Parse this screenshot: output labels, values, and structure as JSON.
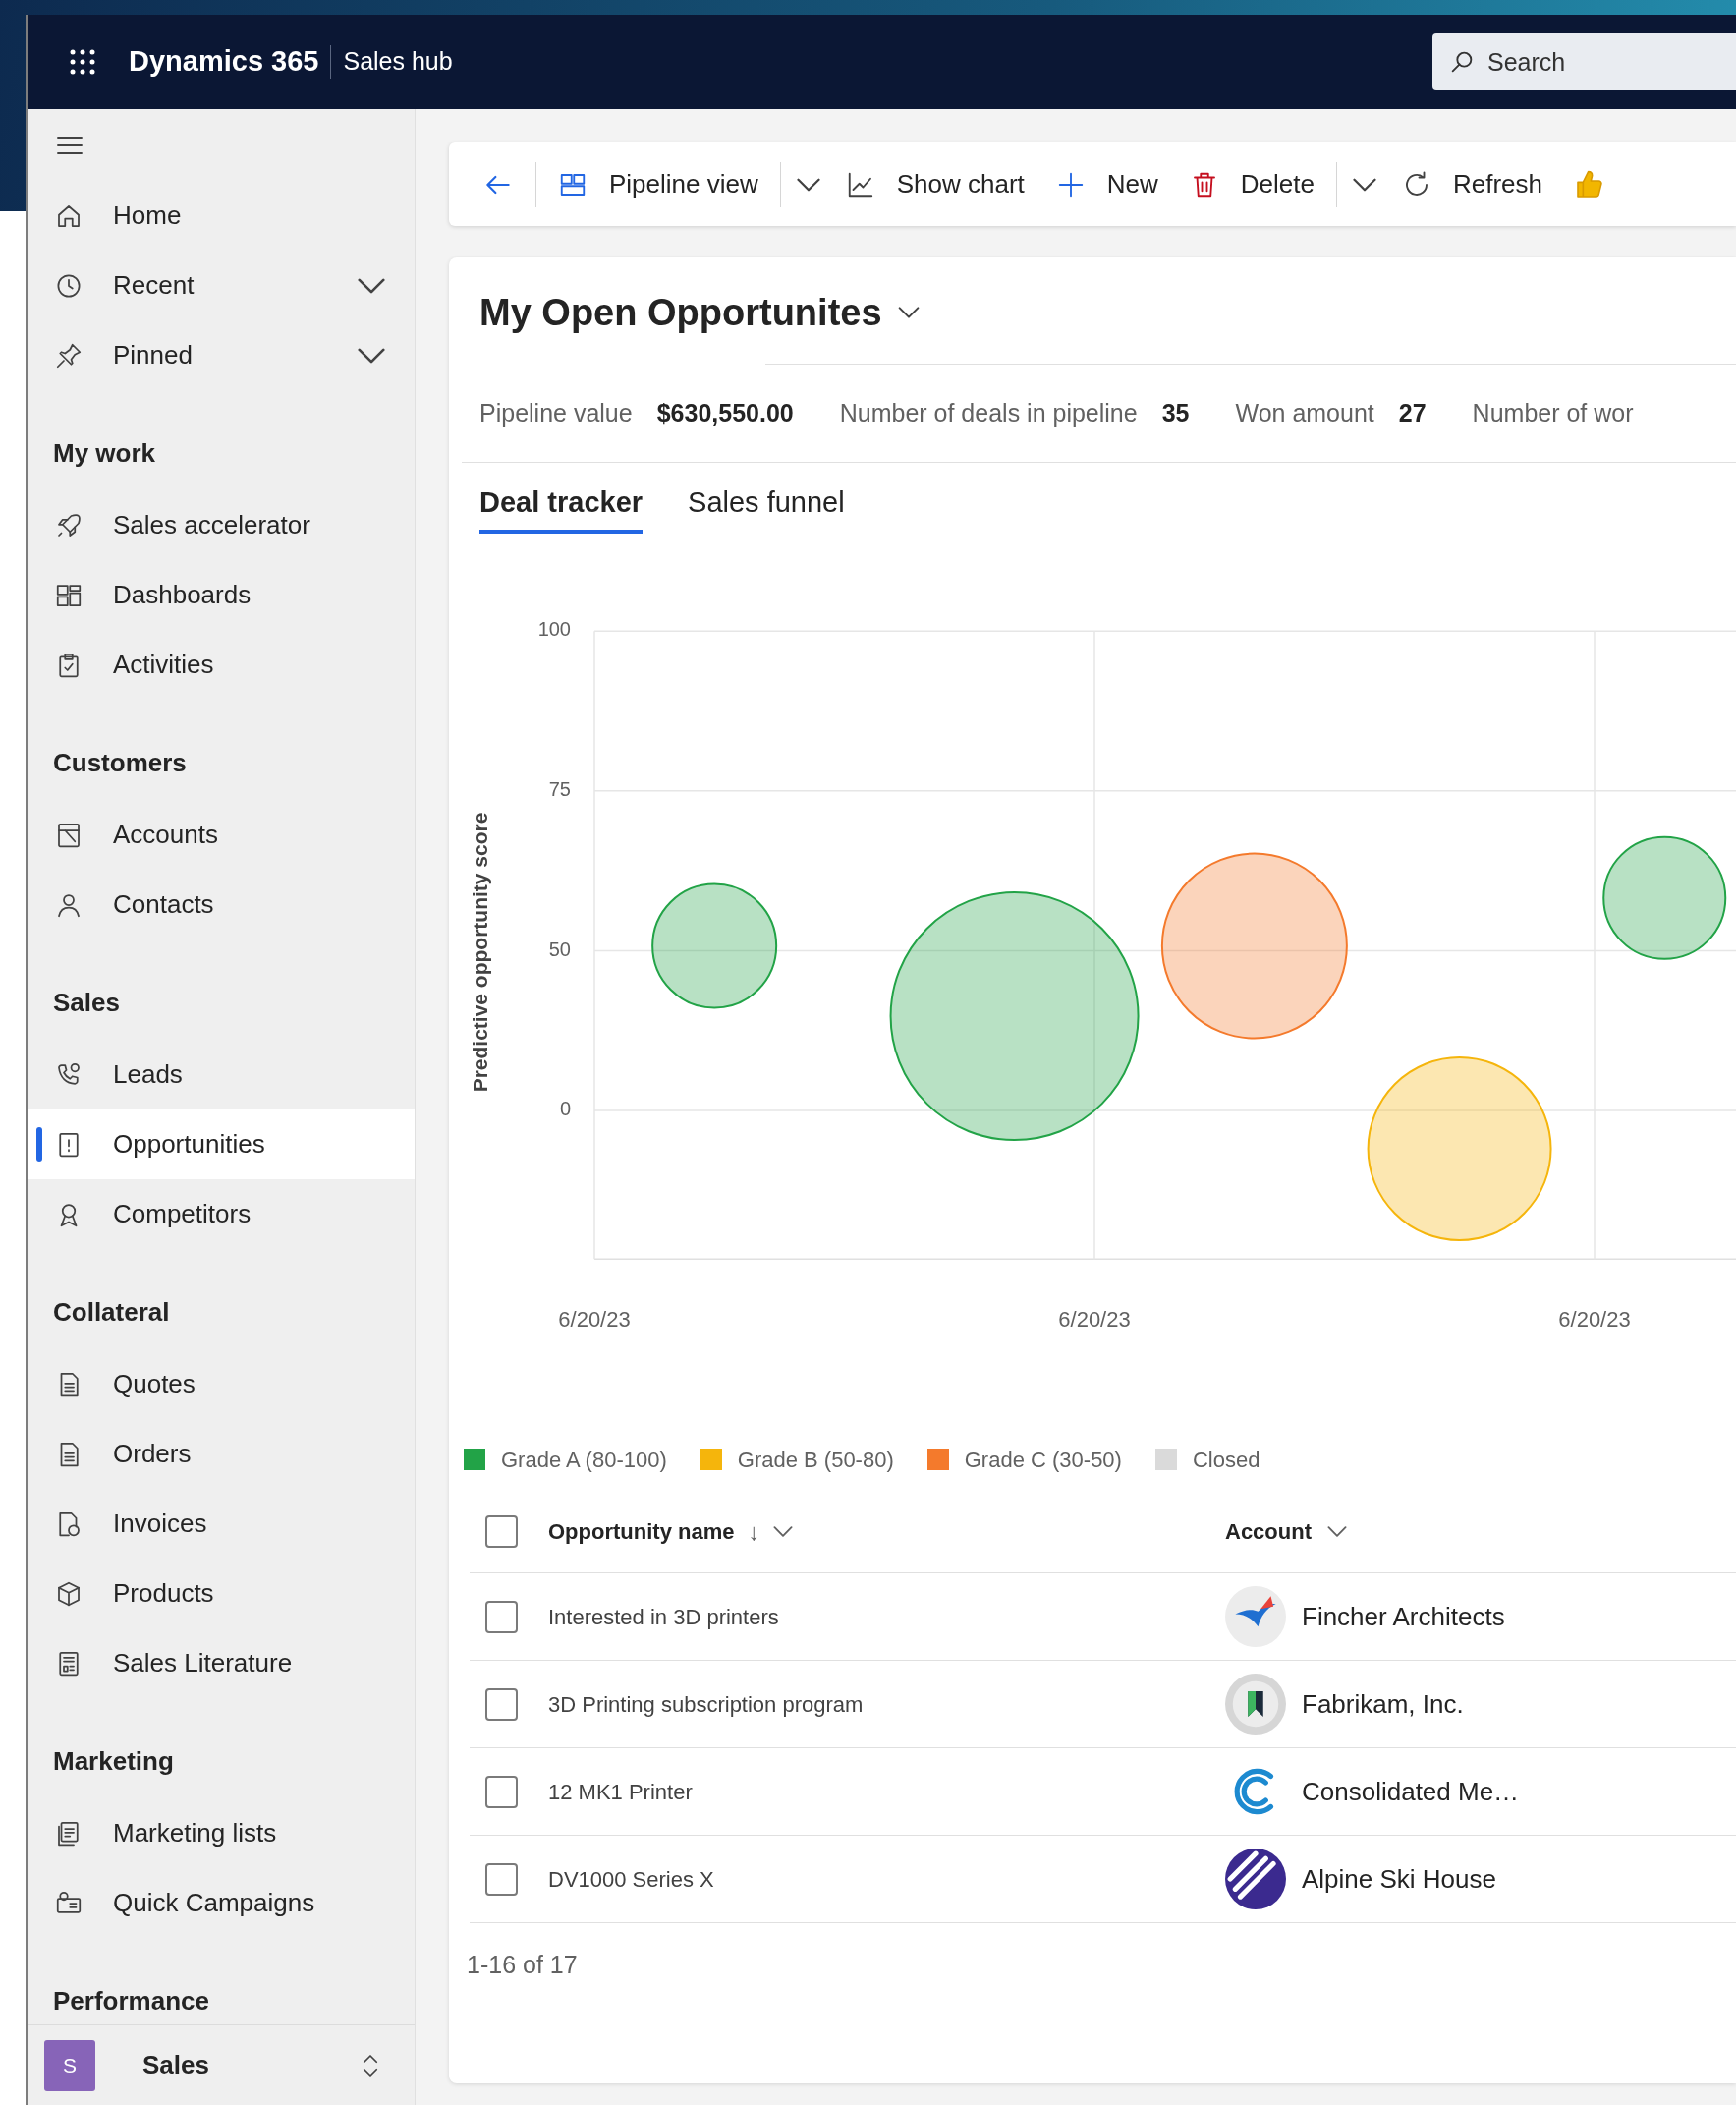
{
  "top_bar": {
    "app_name": "Dynamics 365",
    "area": "Sales hub",
    "search": {
      "placeholder": "Search"
    }
  },
  "sidebar": {
    "groups": [
      {
        "items": [
          {
            "label": "Home",
            "kind": "link",
            "selected": false
          },
          {
            "label": "Recent",
            "kind": "expandable",
            "selected": false
          },
          {
            "label": "Pinned",
            "kind": "expandable",
            "selected": false
          }
        ]
      },
      {
        "header": "My work",
        "items": [
          {
            "label": "Sales accelerator",
            "kind": "link",
            "selected": false
          },
          {
            "label": "Dashboards",
            "kind": "link",
            "selected": false
          },
          {
            "label": "Activities",
            "kind": "link",
            "selected": false
          }
        ]
      },
      {
        "header": "Customers",
        "items": [
          {
            "label": "Accounts",
            "kind": "link",
            "selected": false
          },
          {
            "label": "Contacts",
            "kind": "link",
            "selected": false
          }
        ]
      },
      {
        "header": "Sales",
        "items": [
          {
            "label": "Leads",
            "kind": "link",
            "selected": false
          },
          {
            "label": "Opportunities",
            "kind": "link",
            "selected": true
          },
          {
            "label": "Competitors",
            "kind": "link",
            "selected": false
          }
        ]
      },
      {
        "header": "Collateral",
        "items": [
          {
            "label": "Quotes",
            "kind": "link",
            "selected": false
          },
          {
            "label": "Orders",
            "kind": "link",
            "selected": false
          },
          {
            "label": "Invoices",
            "kind": "link",
            "selected": false
          },
          {
            "label": "Products",
            "kind": "link",
            "selected": false
          },
          {
            "label": "Sales Literature",
            "kind": "link",
            "selected": false
          }
        ]
      },
      {
        "header": "Marketing",
        "items": [
          {
            "label": "Marketing lists",
            "kind": "link",
            "selected": false
          },
          {
            "label": "Quick Campaigns",
            "kind": "link",
            "selected": false
          }
        ]
      },
      {
        "header": "Performance"
      }
    ],
    "area_switcher": {
      "initial": "S",
      "label": "Sales"
    }
  },
  "toolbar": [
    {
      "kind": "back"
    },
    {
      "kind": "button",
      "label": "Pipeline view"
    },
    {
      "kind": "dropdown"
    },
    {
      "kind": "button",
      "label": "Show chart"
    },
    {
      "kind": "button",
      "label": "New"
    },
    {
      "kind": "button",
      "label": "Delete"
    },
    {
      "kind": "dropdown"
    },
    {
      "kind": "button",
      "label": "Refresh"
    },
    {
      "kind": "overflow"
    }
  ],
  "view": {
    "title": "My Open Opportunites",
    "kpis": [
      {
        "label": "Pipeline value",
        "value": "$630,550.00"
      },
      {
        "label": "Number of deals in pipeline",
        "value": "35"
      },
      {
        "label": "Won amount",
        "value": "27"
      },
      {
        "label": "Number of wor"
      }
    ],
    "tabs": [
      {
        "label": "Deal tracker",
        "selected": true
      },
      {
        "label": "Sales funnel",
        "selected": false
      }
    ],
    "chart": {
      "ylabel": "Predictive opportunity score",
      "yticks": [
        "100",
        "75",
        "50",
        "0"
      ],
      "xticks": [
        "6/20/23",
        "6/20/23",
        "6/20/23"
      ],
      "legend": [
        {
          "label": "Grade A (80-100)",
          "color": "#22a347"
        },
        {
          "label": "Grade B (50-80)",
          "color": "#f5b50c"
        },
        {
          "label": "Grade C (30-50)",
          "color": "#f47a2c"
        },
        {
          "label": "Closed",
          "color": "#dadada"
        }
      ]
    },
    "table": {
      "columns": [
        {
          "label": "Opportunity name",
          "sort_mark": "↓"
        },
        {
          "label": "Account"
        }
      ],
      "select_all_checked": false,
      "rows": [
        {
          "checked": false,
          "name": "Interested in 3D printers",
          "account": "Fincher Architects"
        },
        {
          "checked": false,
          "name": "3D Printing subscription program",
          "account": "Fabrikam, Inc."
        },
        {
          "checked": false,
          "name": "12 MK1 Printer",
          "account": "Consolidated Me…"
        },
        {
          "checked": false,
          "name": "DV1000 Series X",
          "account": "Alpine Ski House"
        }
      ],
      "footer": "1-16 of 17"
    }
  }
}
